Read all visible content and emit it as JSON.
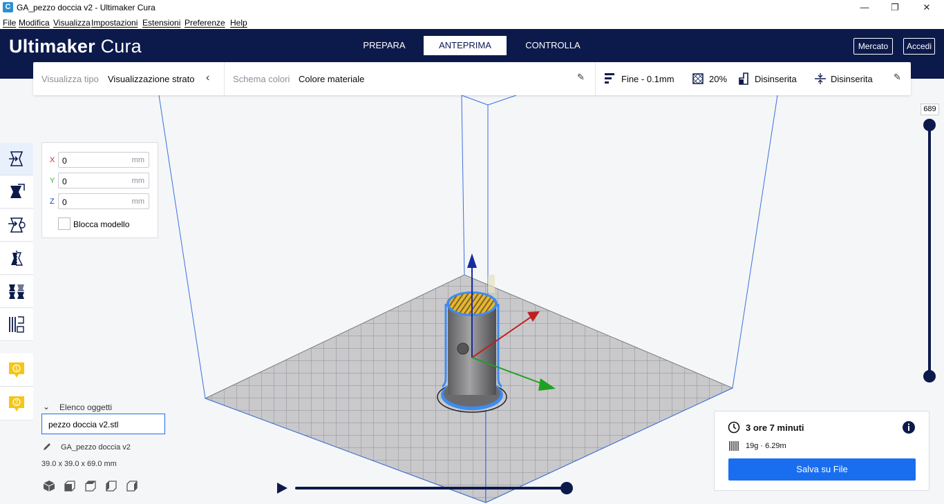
{
  "window": {
    "title": "GA_pezzo doccia v2 - Ultimaker Cura",
    "app_icon_letter": "C",
    "controls": {
      "minimize": "—",
      "maximize": "❐",
      "close": "✕"
    }
  },
  "menubar": {
    "items": [
      "File",
      "Modifica",
      "Visualizza",
      "Impostazioni",
      "Estensioni",
      "Preferenze",
      "Help"
    ]
  },
  "header": {
    "brand_bold": "Ultimaker",
    "brand_light": "Cura",
    "tabs": [
      {
        "label": "PREPARA",
        "active": false
      },
      {
        "label": "ANTEPRIMA",
        "active": true
      },
      {
        "label": "CONTROLLA",
        "active": false
      }
    ],
    "buttons": {
      "market": "Mercato",
      "login": "Accedi"
    },
    "colors": {
      "background": "#0c1a4b",
      "accent": "#196ef0"
    }
  },
  "viewbar": {
    "view_type_label": "Visualizza tipo",
    "view_type_value": "Visualizzazione strato",
    "color_scheme_label": "Schema colori",
    "color_scheme_value": "Colore materiale",
    "profile": "Fine - 0.1mm",
    "infill": "20%",
    "support": "Disinserita",
    "adhesion": "Disinserita"
  },
  "move_panel": {
    "x": {
      "axis": "X",
      "value": "0",
      "unit": "mm",
      "color": "#e02020"
    },
    "y": {
      "axis": "Y",
      "value": "0",
      "unit": "mm",
      "color": "#30b030"
    },
    "z": {
      "axis": "Z",
      "value": "0",
      "unit": "mm",
      "color": "#2040c0"
    },
    "lock_label": "Blocca modello",
    "lock_checked": false
  },
  "toolbar": {
    "tools": [
      "move",
      "scale",
      "rotate",
      "mirror",
      "per-model-settings",
      "support-blocker"
    ],
    "extruders": [
      "1",
      "2"
    ],
    "extruder_color": "#f5c518"
  },
  "object_list": {
    "title": "Elenco oggetti",
    "selected_item": "pezzo doccia v2.stl",
    "job_name": "GA_pezzo doccia v2",
    "dimensions": "39.0 x 39.0 x 69.0 mm"
  },
  "print_info": {
    "time": "3 ore 7 minuti",
    "material": "19g · 6.29m",
    "save_button": "Salva su File"
  },
  "layer_slider": {
    "max_layer": "689",
    "current_top_fraction": 1.0,
    "current_bottom_fraction": 0.0
  },
  "playback": {
    "progress_fraction": 1.0
  }
}
